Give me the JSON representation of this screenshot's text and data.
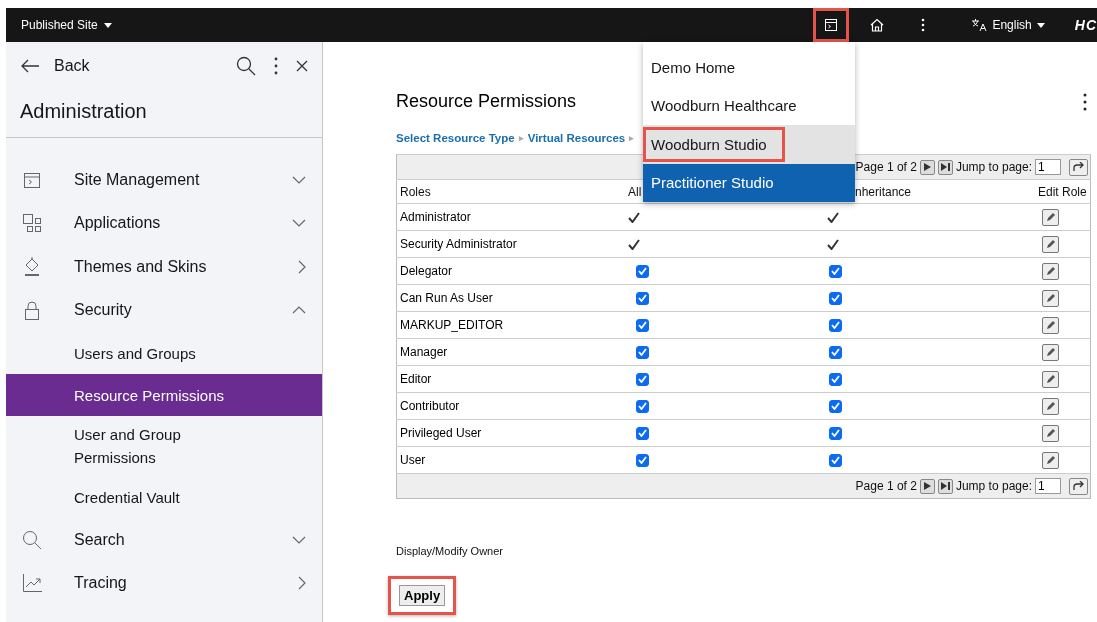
{
  "top_bar": {
    "site_menu": "Published Site",
    "actions": [
      {
        "kind": "site",
        "highlighted": true
      },
      {
        "kind": "home",
        "highlighted": false
      },
      {
        "kind": "more",
        "highlighted": false
      }
    ],
    "language": "English",
    "logo": "HC"
  },
  "sidebar": {
    "back": "Back",
    "title": "Administration",
    "items": [
      {
        "label": "Site Management",
        "kind": "section",
        "expanded": false
      },
      {
        "label": "Applications",
        "kind": "section",
        "expanded": false
      },
      {
        "label": "Themes and Skins",
        "kind": "page"
      },
      {
        "label": "Security",
        "kind": "section",
        "expanded": true,
        "children": [
          {
            "label": "Users and Groups",
            "selected": false
          },
          {
            "label": "Resource Permissions",
            "selected": true
          },
          {
            "label": "User and Group Permissions",
            "selected": false
          },
          {
            "label": "Credential Vault",
            "selected": false
          }
        ]
      },
      {
        "label": "Search",
        "kind": "section",
        "expanded": false
      },
      {
        "label": "Tracing",
        "kind": "page"
      }
    ]
  },
  "main": {
    "title": "Resource Permissions",
    "breadcrumb": [
      "Select Resource Type",
      "Virtual Resources"
    ],
    "breadcrumb_separator": "▸",
    "pager_top": {
      "page": "Page 1 of 2",
      "jump_label": "Jump to page:",
      "jump_value": "1"
    },
    "pager_bottom": {
      "page": "Page 1 of 2",
      "jump_label": "Jump to page:",
      "jump_value": "1"
    },
    "table": {
      "columns": [
        "Roles",
        "All",
        "nheritance",
        "Edit Role"
      ],
      "rows": [
        {
          "role": "Administrator",
          "cells": [
            {
              "kind": "tick"
            },
            {
              "kind": "tick"
            }
          ]
        },
        {
          "role": "Security Administrator",
          "cells": [
            {
              "kind": "tick"
            },
            {
              "kind": "tick"
            }
          ]
        },
        {
          "role": "Delegator",
          "cells": [
            {
              "kind": "checkbox",
              "checked": true
            },
            {
              "kind": "checkbox",
              "checked": true
            }
          ]
        },
        {
          "role": "Can Run As User",
          "cells": [
            {
              "kind": "checkbox",
              "checked": true
            },
            {
              "kind": "checkbox",
              "checked": true
            }
          ]
        },
        {
          "role": "MARKUP_EDITOR",
          "cells": [
            {
              "kind": "checkbox",
              "checked": true
            },
            {
              "kind": "checkbox",
              "checked": true
            }
          ]
        },
        {
          "role": "Manager",
          "cells": [
            {
              "kind": "checkbox",
              "checked": true
            },
            {
              "kind": "checkbox",
              "checked": true
            }
          ]
        },
        {
          "role": "Editor",
          "cells": [
            {
              "kind": "checkbox",
              "checked": true
            },
            {
              "kind": "checkbox",
              "checked": true
            }
          ]
        },
        {
          "role": "Contributor",
          "cells": [
            {
              "kind": "checkbox",
              "checked": true
            },
            {
              "kind": "checkbox",
              "checked": true
            }
          ]
        },
        {
          "role": "Privileged User",
          "cells": [
            {
              "kind": "checkbox",
              "checked": true
            },
            {
              "kind": "checkbox",
              "checked": true
            }
          ]
        },
        {
          "role": "User",
          "cells": [
            {
              "kind": "checkbox",
              "checked": true
            },
            {
              "kind": "checkbox",
              "checked": true
            }
          ]
        }
      ]
    },
    "owner_label": "Display/Modify Owner",
    "apply": {
      "label": "Apply",
      "highlighted": true
    }
  },
  "site_dropdown": {
    "items": [
      {
        "label": "Demo Home",
        "selected": false,
        "hovered": false,
        "highlighted": false
      },
      {
        "label": "Woodburn Healthcare",
        "selected": false,
        "hovered": false,
        "highlighted": false
      },
      {
        "label": "Woodburn Studio",
        "selected": false,
        "hovered": true,
        "highlighted": true
      },
      {
        "label": "Practitioner Studio",
        "selected": true,
        "hovered": false,
        "highlighted": false
      }
    ]
  }
}
